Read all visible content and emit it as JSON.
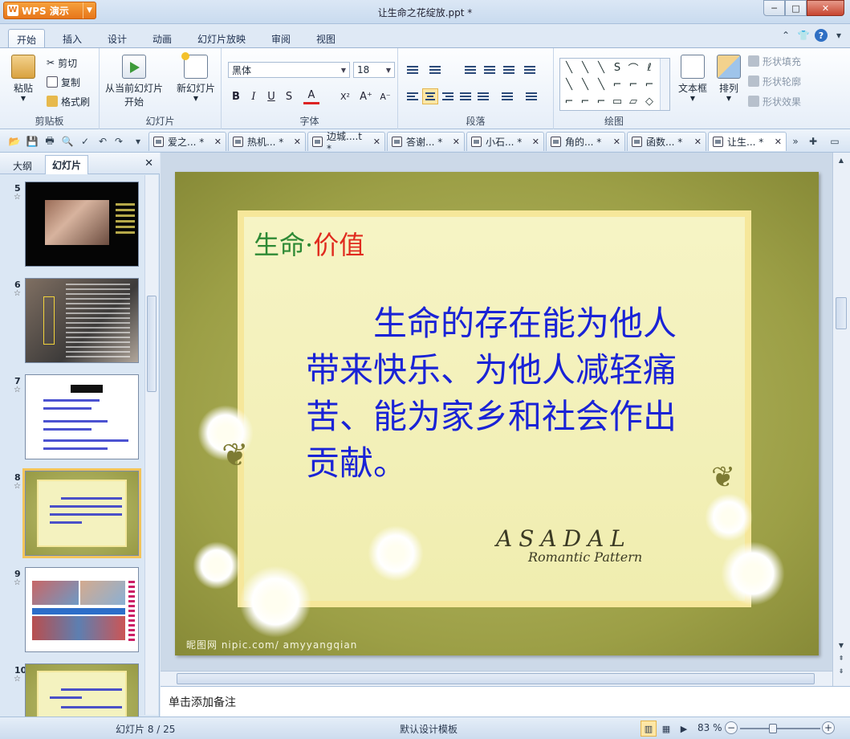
{
  "window": {
    "app_name": "WPS 演示",
    "app_logo": "W",
    "doc_title": "让生命之花绽放.ppt *",
    "minimize": "─",
    "maximize": "□",
    "close": "✕"
  },
  "ribbon_tabs": [
    {
      "label": "开始",
      "active": true
    },
    {
      "label": "插入"
    },
    {
      "label": "设计"
    },
    {
      "label": "动画"
    },
    {
      "label": "幻灯片放映"
    },
    {
      "label": "审阅"
    },
    {
      "label": "视图"
    }
  ],
  "clipboard": {
    "paste": "粘贴",
    "cut": "剪切",
    "copy": "复制",
    "format_painter": "格式刷",
    "group": "剪贴板"
  },
  "slides_group": {
    "from_current": "从当前幻灯片",
    "start": "开始",
    "new_slide": "新幻灯片",
    "group": "幻灯片"
  },
  "font_group": {
    "font_name": "黑体",
    "font_size": "18",
    "bold": "B",
    "italic": "I",
    "underline": "U",
    "shadow": "S",
    "font_color": "A",
    "superscript": "X²",
    "grow": "A⁺",
    "shrink": "A⁻",
    "group": "字体"
  },
  "paragraph_group": {
    "group": "段落"
  },
  "drawing_group": {
    "shape_symbols": [
      "╲",
      "╲",
      "╲",
      "S",
      "⌒",
      "ℓ",
      "╲",
      "╲",
      "╲",
      "⌐",
      "⌐",
      "⌐",
      "⌐",
      "⌐",
      "⌐",
      "⊓",
      "▭",
      "▱",
      "◇"
    ],
    "textbox": "文本框",
    "arrange": "排列",
    "shape_fill": "形状填充",
    "shape_outline": "形状轮廓",
    "shape_effect": "形状效果",
    "group": "绘图"
  },
  "doc_tabs": [
    {
      "label": "爱之... *"
    },
    {
      "label": "热机... *"
    },
    {
      "label": "边城....t *"
    },
    {
      "label": "答谢... *"
    },
    {
      "label": "小石... *"
    },
    {
      "label": "角的... *"
    },
    {
      "label": "函数... *"
    },
    {
      "label": "让生... *",
      "active": true
    }
  ],
  "left_panel": {
    "tab_outline": "大纲",
    "tab_slides": "幻灯片",
    "close": "✕",
    "thumbnails": [
      {
        "num": "5"
      },
      {
        "num": "6"
      },
      {
        "num": "7"
      },
      {
        "num": "8",
        "selected": true
      },
      {
        "num": "9"
      },
      {
        "num": "10"
      }
    ]
  },
  "slide": {
    "title_part1": "生命·",
    "title_part2": "价值",
    "body": "生命的存在能为他人带来快乐、为他人减轻痛苦、能为家乡和社会作出贡献。",
    "watermark": "昵图网 nipic.com/ amyyangqian",
    "deco_line1": "ASADAL",
    "deco_line2": "Romantic Pattern"
  },
  "notes_placeholder": "单击添加备注",
  "status": {
    "slide_info": "幻灯片 8 / 25",
    "template": "默认设计模板",
    "zoom": "83 %"
  },
  "colors": {
    "title_green": "#2e8a35",
    "title_red": "#e02a1e",
    "body_blue": "#1a23d6"
  }
}
